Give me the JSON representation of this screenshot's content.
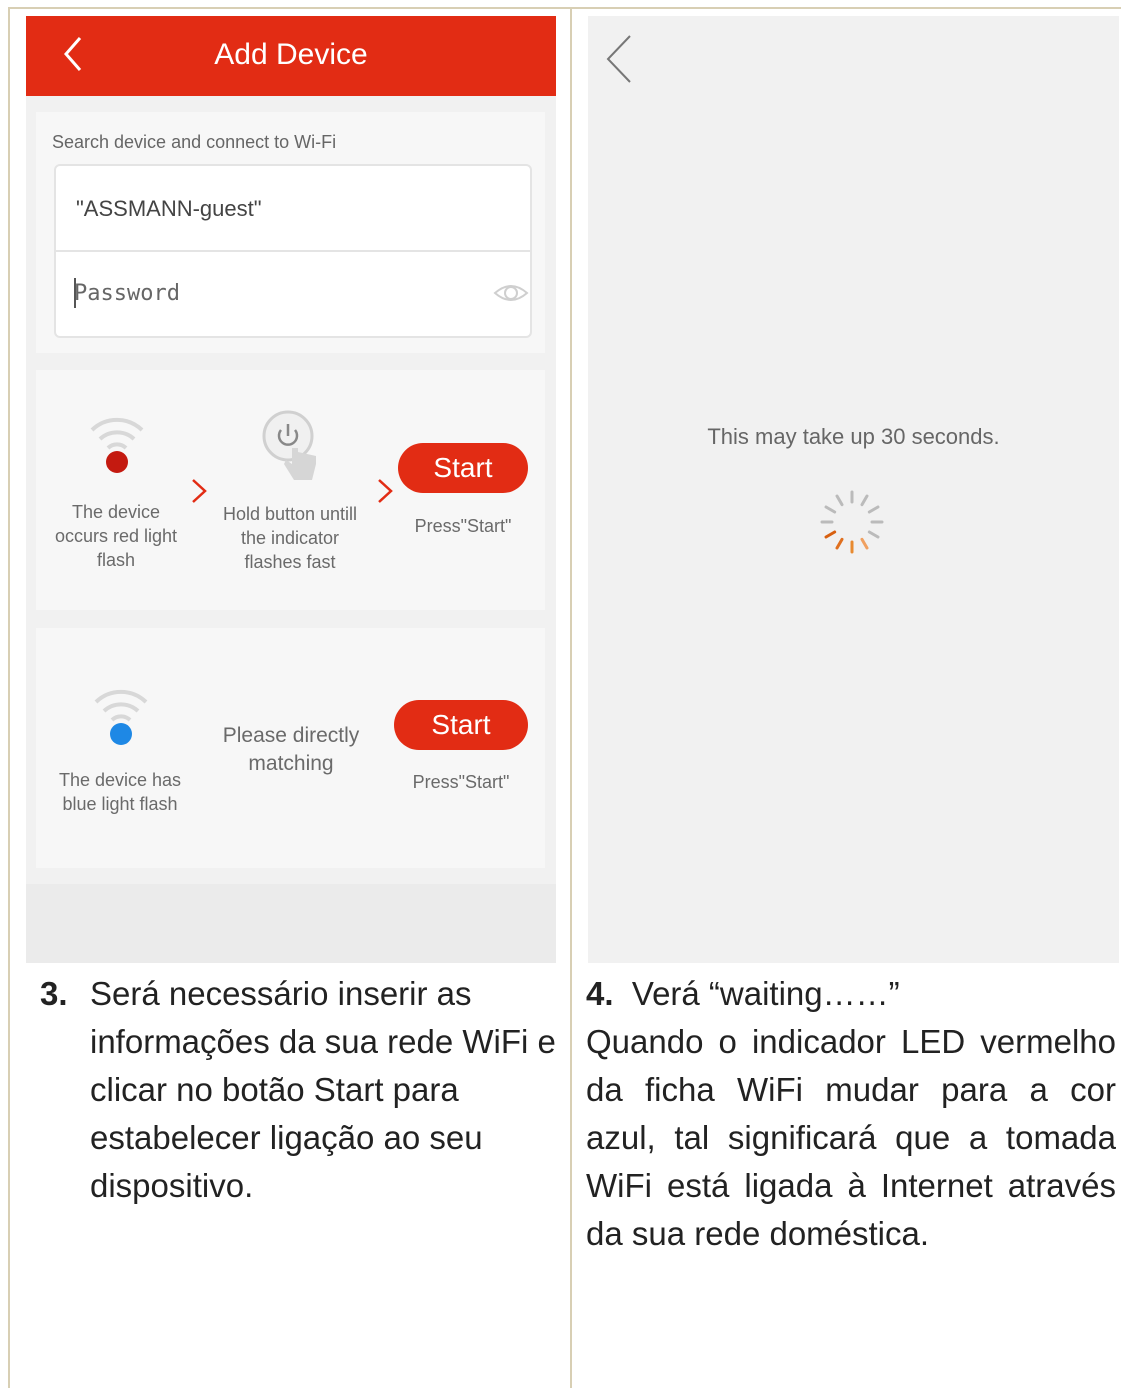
{
  "left_screen": {
    "app_title": "Add Device",
    "wifi_hint": "Search device and connect to Wi-Fi",
    "ssid_value": "\"ASSMANN-guest\"",
    "password_placeholder": "Password",
    "red_flow": {
      "step1_text": "The device occurs red light flash",
      "step2_text": "Hold button untill the indicator flashes fast",
      "start_label": "Start",
      "press_text": "Press\"Start\""
    },
    "blue_flow": {
      "step1_text": "The device has blue light flash",
      "step2_text": "Please directly matching",
      "start_label": "Start",
      "press_text": "Press\"Start\""
    }
  },
  "right_screen": {
    "wait_text": "This may take up 30 seconds."
  },
  "captions": {
    "left_num": "3.",
    "left_text": "Será necessário inserir as informações da sua rede WiFi e clicar no botão Start para estabelecer ligação ao seu dispositivo.",
    "right_num": "4.",
    "right_line1": "Verá “waiting……”",
    "right_text": "Quando o indicador LED vermelho da ficha WiFi mudar para a cor azul, tal significará que a tomada WiFi está ligada à Internet através da sua rede doméstica."
  },
  "icons": {
    "back": "chevron-left-icon",
    "eye": "eye-icon",
    "wifi": "wifi-icon",
    "power_touch": "power-touch-icon",
    "arrow": "chevron-right-icon",
    "spinner": "loading-spinner-icon"
  },
  "colors": {
    "accent": "#e22c14",
    "red_led": "#c41a10",
    "blue_led": "#1e88e5"
  }
}
